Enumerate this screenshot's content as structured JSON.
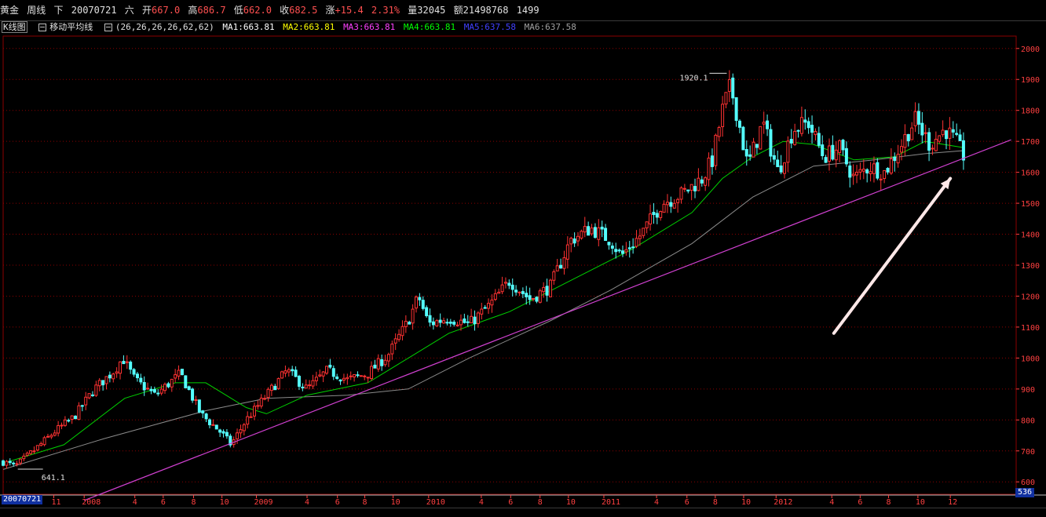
{
  "header": {
    "instrument": "黄金",
    "period": "周线",
    "direction": "下",
    "date": "20070721",
    "weekday": "六",
    "open_label": "开",
    "open": "667.0",
    "high_label": "高",
    "high": "686.7",
    "low_label": "低",
    "low": "662.0",
    "close_label": "收",
    "close": "682.5",
    "change_label": "涨",
    "change": "+15.4",
    "change_pct": "2.31%",
    "volume_label": "量",
    "volume": "32045",
    "amount_label": "额",
    "amount": "21498768",
    "extra": "1499"
  },
  "ma_bar": {
    "kline_label": "K线图",
    "ma_label": "移动平均线",
    "params": "(26,26,26,26,62,62)",
    "ma1": "MA1:663.81",
    "ma2": "MA2:663.81",
    "ma3": "MA3:663.81",
    "ma4": "MA4:663.81",
    "ma5": "MA5:637.58",
    "ma6": "MA6:637.58"
  },
  "bottom": {
    "date_box": "20070721",
    "price_box": "536"
  },
  "colors": {
    "up": "#ff3232",
    "down": "#54ffff",
    "grid": "#8b0000",
    "axis_text": "#ff4040",
    "ma_green": "#00d000",
    "ma_grey": "#8a8a8a",
    "trendline": "#d040d0",
    "arrow": "#ffe8e8",
    "ma1": "#ffffff",
    "ma2": "#ffff00",
    "ma3": "#ff40ff",
    "ma4": "#00ff00",
    "ma5": "#4040ff",
    "ma6": "#a0a0a0"
  },
  "chart_data": {
    "type": "candlestick",
    "title": "黄金 周线",
    "ylim": [
      560,
      2040
    ],
    "yticks": [
      600,
      700,
      800,
      900,
      1000,
      1100,
      1200,
      1300,
      1400,
      1500,
      1600,
      1700,
      1800,
      1900,
      2000
    ],
    "x_axis_labels": [
      {
        "text": "11",
        "x": 0.05
      },
      {
        "text": "2008",
        "x": 0.08
      },
      {
        "text": "4",
        "x": 0.13
      },
      {
        "text": "6",
        "x": 0.158
      },
      {
        "text": "8",
        "x": 0.188
      },
      {
        "text": "10",
        "x": 0.216
      },
      {
        "text": "2009",
        "x": 0.25
      },
      {
        "text": "4",
        "x": 0.3
      },
      {
        "text": "6",
        "x": 0.33
      },
      {
        "text": "8",
        "x": 0.357
      },
      {
        "text": "10",
        "x": 0.385
      },
      {
        "text": "2010",
        "x": 0.42
      },
      {
        "text": "4",
        "x": 0.472
      },
      {
        "text": "6",
        "x": 0.501
      },
      {
        "text": "8",
        "x": 0.53
      },
      {
        "text": "10",
        "x": 0.558
      },
      {
        "text": "2011",
        "x": 0.593
      },
      {
        "text": "4",
        "x": 0.645
      },
      {
        "text": "6",
        "x": 0.675
      },
      {
        "text": "8",
        "x": 0.703
      },
      {
        "text": "10",
        "x": 0.731
      },
      {
        "text": "2012",
        "x": 0.763
      },
      {
        "text": "4",
        "x": 0.818
      },
      {
        "text": "6",
        "x": 0.846
      },
      {
        "text": "8",
        "x": 0.874
      },
      {
        "text": "10",
        "x": 0.903
      },
      {
        "text": "12",
        "x": 0.935
      }
    ],
    "anchor_points": [
      {
        "x": 0.0,
        "price": 665
      },
      {
        "x": 0.012,
        "price": 650
      },
      {
        "x": 0.03,
        "price": 700
      },
      {
        "x": 0.05,
        "price": 760
      },
      {
        "x": 0.07,
        "price": 810
      },
      {
        "x": 0.09,
        "price": 900
      },
      {
        "x": 0.11,
        "price": 960
      },
      {
        "x": 0.118,
        "price": 1000
      },
      {
        "x": 0.13,
        "price": 930
      },
      {
        "x": 0.15,
        "price": 880
      },
      {
        "x": 0.175,
        "price": 950
      },
      {
        "x": 0.195,
        "price": 820
      },
      {
        "x": 0.215,
        "price": 760
      },
      {
        "x": 0.225,
        "price": 720
      },
      {
        "x": 0.24,
        "price": 800
      },
      {
        "x": 0.26,
        "price": 880
      },
      {
        "x": 0.28,
        "price": 960
      },
      {
        "x": 0.3,
        "price": 900
      },
      {
        "x": 0.32,
        "price": 960
      },
      {
        "x": 0.34,
        "price": 930
      },
      {
        "x": 0.36,
        "price": 950
      },
      {
        "x": 0.38,
        "price": 1010
      },
      {
        "x": 0.4,
        "price": 1120
      },
      {
        "x": 0.41,
        "price": 1200
      },
      {
        "x": 0.42,
        "price": 1110
      },
      {
        "x": 0.44,
        "price": 1130
      },
      {
        "x": 0.46,
        "price": 1110
      },
      {
        "x": 0.48,
        "price": 1170
      },
      {
        "x": 0.5,
        "price": 1250
      },
      {
        "x": 0.52,
        "price": 1190
      },
      {
        "x": 0.54,
        "price": 1230
      },
      {
        "x": 0.56,
        "price": 1380
      },
      {
        "x": 0.58,
        "price": 1420
      },
      {
        "x": 0.6,
        "price": 1380
      },
      {
        "x": 0.61,
        "price": 1330
      },
      {
        "x": 0.63,
        "price": 1400
      },
      {
        "x": 0.65,
        "price": 1500
      },
      {
        "x": 0.67,
        "price": 1530
      },
      {
        "x": 0.69,
        "price": 1580
      },
      {
        "x": 0.7,
        "price": 1640
      },
      {
        "x": 0.71,
        "price": 1800
      },
      {
        "x": 0.718,
        "price": 1880
      },
      {
        "x": 0.725,
        "price": 1780
      },
      {
        "x": 0.735,
        "price": 1620
      },
      {
        "x": 0.75,
        "price": 1760
      },
      {
        "x": 0.765,
        "price": 1600
      },
      {
        "x": 0.78,
        "price": 1740
      },
      {
        "x": 0.795,
        "price": 1760
      },
      {
        "x": 0.81,
        "price": 1650
      },
      {
        "x": 0.825,
        "price": 1680
      },
      {
        "x": 0.84,
        "price": 1580
      },
      {
        "x": 0.855,
        "price": 1620
      },
      {
        "x": 0.87,
        "price": 1600
      },
      {
        "x": 0.885,
        "price": 1680
      },
      {
        "x": 0.9,
        "price": 1770
      },
      {
        "x": 0.915,
        "price": 1690
      },
      {
        "x": 0.93,
        "price": 1740
      },
      {
        "x": 0.94,
        "price": 1700
      },
      {
        "x": 0.948,
        "price": 1655
      }
    ],
    "ma_green_points": [
      {
        "x": 0.0,
        "price": 660
      },
      {
        "x": 0.06,
        "price": 720
      },
      {
        "x": 0.12,
        "price": 870
      },
      {
        "x": 0.17,
        "price": 920
      },
      {
        "x": 0.2,
        "price": 920
      },
      {
        "x": 0.24,
        "price": 840
      },
      {
        "x": 0.26,
        "price": 820
      },
      {
        "x": 0.3,
        "price": 880
      },
      {
        "x": 0.36,
        "price": 920
      },
      {
        "x": 0.4,
        "price": 1000
      },
      {
        "x": 0.44,
        "price": 1080
      },
      {
        "x": 0.5,
        "price": 1150
      },
      {
        "x": 0.56,
        "price": 1250
      },
      {
        "x": 0.62,
        "price": 1350
      },
      {
        "x": 0.68,
        "price": 1470
      },
      {
        "x": 0.71,
        "price": 1580
      },
      {
        "x": 0.74,
        "price": 1650
      },
      {
        "x": 0.77,
        "price": 1700
      },
      {
        "x": 0.8,
        "price": 1690
      },
      {
        "x": 0.84,
        "price": 1640
      },
      {
        "x": 0.88,
        "price": 1650
      },
      {
        "x": 0.91,
        "price": 1700
      },
      {
        "x": 0.948,
        "price": 1680
      }
    ],
    "ma_grey_points": [
      {
        "x": 0.0,
        "price": 640
      },
      {
        "x": 0.1,
        "price": 740
      },
      {
        "x": 0.2,
        "price": 830
      },
      {
        "x": 0.26,
        "price": 870
      },
      {
        "x": 0.34,
        "price": 880
      },
      {
        "x": 0.4,
        "price": 900
      },
      {
        "x": 0.46,
        "price": 1000
      },
      {
        "x": 0.54,
        "price": 1120
      },
      {
        "x": 0.6,
        "price": 1220
      },
      {
        "x": 0.68,
        "price": 1370
      },
      {
        "x": 0.74,
        "price": 1520
      },
      {
        "x": 0.8,
        "price": 1620
      },
      {
        "x": 0.86,
        "price": 1640
      },
      {
        "x": 0.91,
        "price": 1660
      },
      {
        "x": 0.948,
        "price": 1670
      }
    ],
    "trendline": [
      {
        "x": 0.08,
        "price": 540
      },
      {
        "x": 0.995,
        "price": 1705
      }
    ],
    "annotations": [
      {
        "text": "1920.1",
        "x": 0.705,
        "price": 1920
      },
      {
        "text": "641.1",
        "x": 0.03,
        "price": 641
      }
    ],
    "arrow": [
      {
        "x": 0.82,
        "price": 1080
      },
      {
        "x": 0.935,
        "price": 1580
      }
    ]
  }
}
